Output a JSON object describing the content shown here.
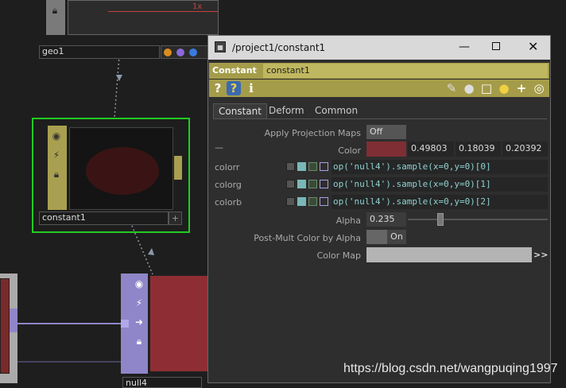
{
  "network": {
    "geo1": {
      "label": "geo1",
      "viewer_axis_label": "1x"
    },
    "constant1": {
      "label": "constant1"
    },
    "null4": {
      "label": "null4"
    }
  },
  "param_window": {
    "title": "/project1/constant1",
    "op_type": "Constant",
    "op_name": "constant1",
    "tabs": [
      "Constant",
      "Deform",
      "Common"
    ],
    "active_tab": "Constant",
    "params": {
      "apply_proj": {
        "label": "Apply Projection Maps",
        "value": "Off"
      },
      "color": {
        "label": "Color",
        "r": "0.49803",
        "g": "0.18039",
        "b": "0.20392",
        "swatch": "#7f2e34"
      },
      "colorr": {
        "label": "colorr",
        "expr": "op('null4').sample(x=0,y=0)[0]"
      },
      "colorg": {
        "label": "colorg",
        "expr": "op('null4').sample(x=0,y=0)[1]"
      },
      "colorb": {
        "label": "colorb",
        "expr": "op('null4').sample(x=0,y=0)[2]"
      },
      "alpha": {
        "label": "Alpha",
        "value": "0.235",
        "fraction": 0.235
      },
      "post_mult": {
        "label": "Post-Mult Color by Alpha",
        "value": "On"
      },
      "color_map": {
        "label": "Color Map",
        "value": "",
        "expand": ">>"
      }
    },
    "collapse_marker": "—"
  },
  "watermark": "https://blog.csdn.net/wangpuqing1997",
  "colors": {
    "top_accent": "#a59c4a",
    "select_green": "#22cc22",
    "null_purple": "#8e86c8",
    "param_expr": "#8fd0d0"
  }
}
